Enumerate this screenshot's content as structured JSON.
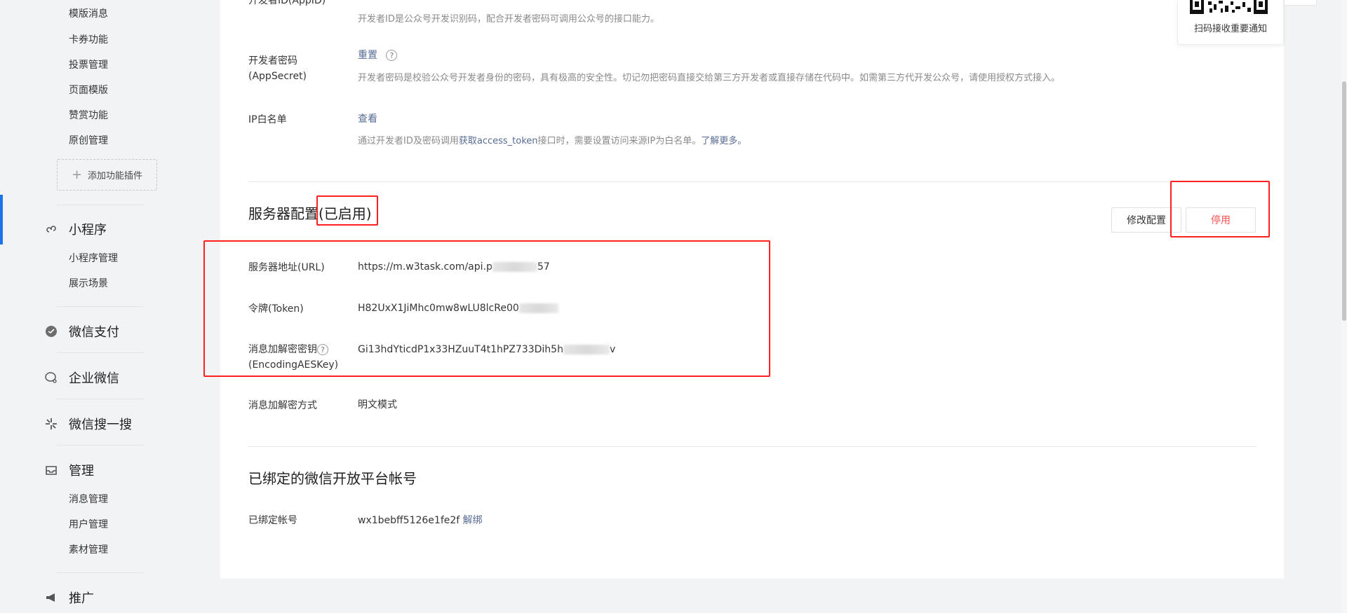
{
  "sidebar": {
    "plugin_items": [
      "模版消息",
      "卡券功能",
      "投票管理",
      "页面模版",
      "赞赏功能",
      "原创管理"
    ],
    "add_plugin_label": "添加功能插件",
    "groups": {
      "mini_program": {
        "label": "小程序",
        "items": [
          "小程序管理",
          "展示场景"
        ]
      },
      "wechat_pay": {
        "label": "微信支付"
      },
      "work_wechat": {
        "label": "企业微信"
      },
      "wechat_search": {
        "label": "微信搜一搜"
      },
      "management": {
        "label": "管理",
        "items": [
          "消息管理",
          "用户管理",
          "素材管理"
        ]
      },
      "promotion": {
        "label": "推广"
      }
    }
  },
  "dev_info": {
    "appid": {
      "label": "开发者ID(AppID)",
      "desc": "开发者ID是公众号开发识别码，配合开发者密码可调用公众号的接口能力。"
    },
    "appsecret": {
      "label_line1": "开发者密码",
      "label_line2": "(AppSecret)",
      "action": "重置",
      "desc": "开发者密码是校验公众号开发者身份的密码，具有极高的安全性。切记勿把密码直接交给第三方开发者或直接存储在代码中。如需第三方代开发公众号，请使用授权方式接入。"
    },
    "ip_whitelist": {
      "label": "IP白名单",
      "action": "查看",
      "desc_prefix": "通过开发者ID及密码调用",
      "desc_link": "获取access_token",
      "desc_middle": "接口时，需要设置访问来源IP为白名单。",
      "desc_more": "了解更多。"
    }
  },
  "server_config": {
    "title": "服务器配置",
    "status": "(已启用)",
    "modify_button": "修改配置",
    "disable_button": "停用",
    "url": {
      "label": "服务器地址(URL)",
      "value_prefix": "https://m.w3task.com/api.p",
      "value_suffix": "57"
    },
    "token": {
      "label": "令牌(Token)",
      "value_prefix": "H82UxX1JiMhc0mw8wLU8lcRe00"
    },
    "aes_key": {
      "label_line1": "消息加解密密钥",
      "label_line2": "(EncodingAESKey)",
      "value_prefix": "Gi13hdYticdP1x33HZuuT4t1hPZ733Dih5h",
      "value_suffix": "v"
    },
    "encrypt_mode": {
      "label": "消息加解密方式",
      "value": "明文模式"
    }
  },
  "bound_platform": {
    "title": "已绑定的微信开放平台帐号",
    "account": {
      "label": "已绑定帐号",
      "value": "wx1bebff5126e1fe2f",
      "action": "解绑"
    }
  },
  "qr_widget": {
    "caption": "扫码接收重要通知"
  }
}
